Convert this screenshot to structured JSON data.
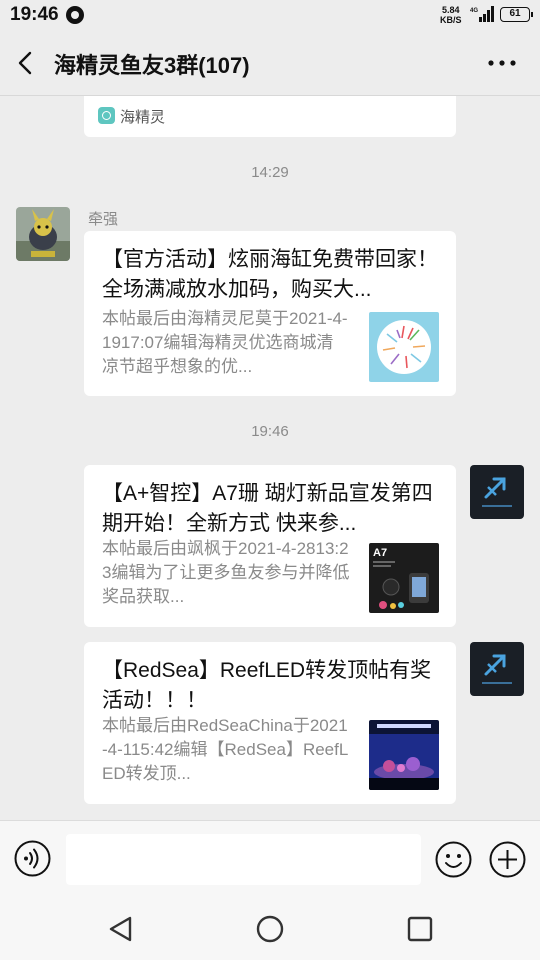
{
  "status_bar": {
    "time": "19:46",
    "speed_value": "5.84",
    "speed_unit": "KB/S",
    "network": "4G",
    "battery": "61"
  },
  "header": {
    "title": "海精灵鱼友3群(107)"
  },
  "source_card": {
    "label": "海精灵"
  },
  "timestamps": [
    "14:29",
    "19:46"
  ],
  "messages": [
    {
      "sender": "牵强",
      "title": "【官方活动】炫丽海缸免费带回家！全场满减放水加码，购买大...",
      "desc": "本帖最后由海精灵尼莫于2021-4-1917:07编辑海精灵优选商城清凉节超乎想象的优..."
    },
    {
      "sender": "",
      "title": "【A+智控】A7珊 瑚灯新品宣发第四期开始！全新方式  快来参...",
      "desc": "本帖最后由飒枫于2021-4-2813:23编辑为了让更多鱼友参与并降低奖品获取...",
      "thumb_label": "A7"
    },
    {
      "sender": "",
      "title": "【RedSea】ReefLED转发顶帖有奖活动！！！",
      "desc": "本帖最后由RedSeaChina于2021-4-115:42编辑【RedSea】ReefLED转发顶..."
    }
  ],
  "input": {
    "placeholder": ""
  },
  "colors": {
    "background": "#ededed",
    "bubble": "#ffffff",
    "muted_text": "#8a8a8a"
  }
}
